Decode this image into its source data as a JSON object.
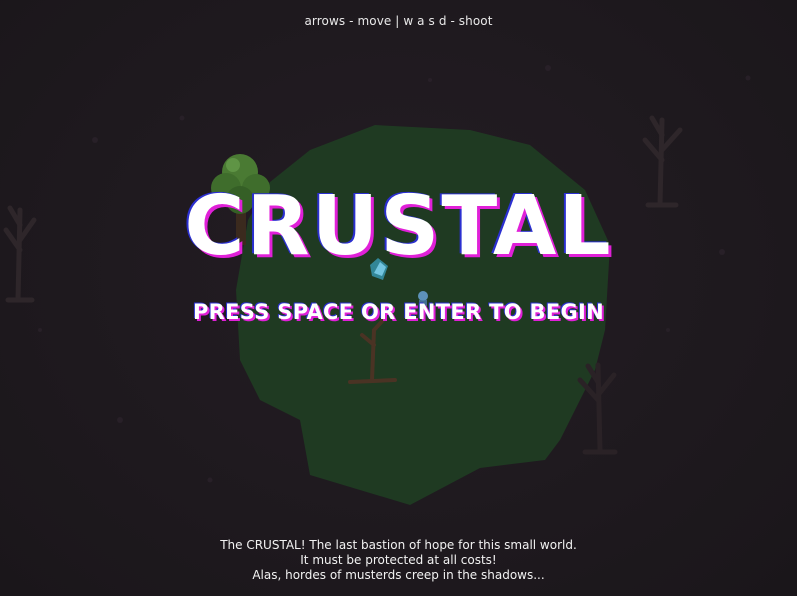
{
  "hud": {
    "controls_hint": "arrows - move | w a s d - shoot"
  },
  "title_screen": {
    "title": "CRUSTAL",
    "start_prompt": "PRESS SPACE OR ENTER TO BEGIN",
    "story_lines": [
      "The CRUSTAL! The last bastion of hope for this small world.",
      "It must be protected at all costs!",
      "Alas, hordes of musterds creep in the shadows..."
    ]
  },
  "colors": {
    "background": "#1f1a1f",
    "lit_area": "#1f3a22",
    "title_text": "#ffffff",
    "title_shadow_pink": "#e020d8",
    "title_shadow_blue": "#2b2fd0"
  },
  "scene_icons": [
    "tree-icon",
    "dead-tree-icon",
    "crystal-icon",
    "player-icon"
  ]
}
